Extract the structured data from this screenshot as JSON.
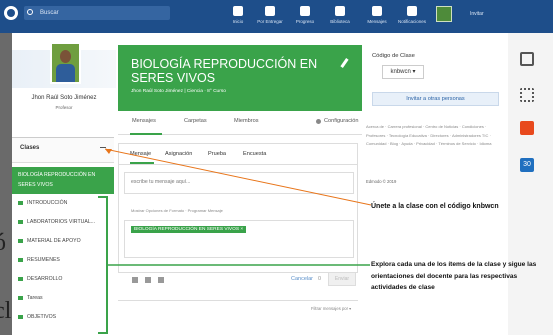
{
  "topbar": {
    "search_placeholder": "Buscar",
    "nav": [
      {
        "label": "Inicio",
        "icon": "home-icon"
      },
      {
        "label": "Por Entregar",
        "icon": "calendar-icon"
      },
      {
        "label": "Progreso",
        "icon": "progress-icon"
      },
      {
        "label": "Biblioteca",
        "icon": "library-icon"
      },
      {
        "label": "Mensajes",
        "icon": "chat-icon"
      },
      {
        "label": "Notificaciones",
        "icon": "bell-icon"
      }
    ],
    "invite_label": "Invitar"
  },
  "profile": {
    "name": "Jhon Raúl Soto Jiménez",
    "role": "Profesor"
  },
  "sidebar": {
    "title": "Clases",
    "active_class": "BIOLOGÍA REPRODUCCIÓN EN SERES VIVOS",
    "items": [
      {
        "label": "INTRODUCCIÓN"
      },
      {
        "label": "LABORATORIOS VIRTUAL..."
      },
      {
        "label": "MATERIAL DE APOYO"
      },
      {
        "label": "RESUMENES"
      },
      {
        "label": "DESARROLLO"
      },
      {
        "label": "Tareas"
      },
      {
        "label": "OBJETIVOS"
      }
    ]
  },
  "overlay_letters": {
    "top": "ó",
    "bottom": "cl"
  },
  "banner": {
    "title": "BIOLOGÍA REPRODUCCIÓN EN SERES VIVOS",
    "subtitle": "Jhon Raúl Soto Jiménez | Ciencia · 8° Curso"
  },
  "tabs": [
    "Mensajes",
    "Carpetas",
    "Miembros"
  ],
  "settings_label": "Configuración",
  "composer": {
    "tabs": [
      "Mensaje",
      "Asignación",
      "Prueba",
      "Encuesta"
    ],
    "placeholder": "escribe tu mensaje aquí...",
    "format_options": "Mostrar Opciones de Formato · Programar Mensaje",
    "recipient": "BIOLOGÍA REPRODUCCIÓN EN SERES VIVOS ×",
    "cancel_label": "Cancelar",
    "count": "0",
    "send_label": "Enviar"
  },
  "filter_label": "Filtrar mensajes por ▾",
  "class_code": {
    "label": "Código de Clase",
    "code": "knbwcn",
    "invite_button": "Invitar a otras personas"
  },
  "footer_links": "Acerca de · Carrera profesional · Centro de Noticias · Condiciones · Profesores · Tecnología Educativa · Directores · Administradores TIC · Comunidad · Blog · Ayuda · Privacidad · Términos de Servicio · Idioma",
  "copyright": "Edmodo © 2019",
  "rail_icons": [
    "tablet-icon",
    "apps-grid-icon",
    "office-icon",
    "calendar-30-icon"
  ],
  "rail_calendar_number": "30",
  "annotations": {
    "join_code": "Únete a la clase con el código knbwcn",
    "explore": "Explora cada una de los ítems de la clase y sigue las orientaciones del docente para las respectivas actividades de clase"
  },
  "colors": {
    "brand_blue": "#1e4e8a",
    "accent_green": "#3aa34a"
  }
}
